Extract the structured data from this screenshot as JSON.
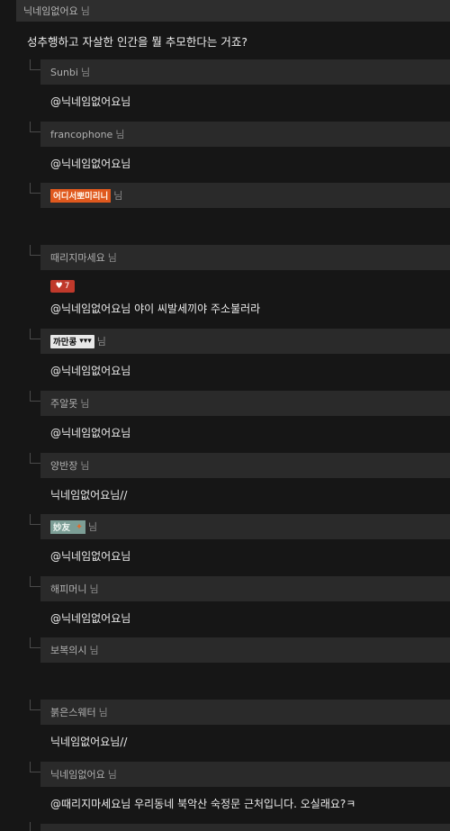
{
  "post": {
    "author": "닉네임없어요",
    "suffix": "님",
    "text": "성추행하고 자살한 인간을 뭘 추모한다는 거죠?"
  },
  "replies": [
    {
      "nick": "Sunbi",
      "suffix": "님",
      "body": "@닉네임없어요님"
    },
    {
      "nick": "francophone",
      "suffix": "님",
      "body": "@닉네임없어요님"
    },
    {
      "nick": "어디서뽀미리니",
      "suffix": "님",
      "body": ""
    },
    {
      "nick": "때리지마세요",
      "suffix": "님",
      "likes": "7",
      "body": "@닉네임없어요님 야이 씨발세끼야 주소불러라"
    },
    {
      "nick": "까만콩",
      "suffix": "님",
      "body": "@닉네임없어요님"
    },
    {
      "nick": "주알못",
      "suffix": "님",
      "body": "@닉네임없어요님"
    },
    {
      "nick": "양반장",
      "suffix": "님",
      "body": "닉네임없어요님//"
    },
    {
      "nick": "妙友",
      "suffix": "님",
      "body": "@닉네임없어요님"
    },
    {
      "nick": "해피머니",
      "suffix": "님",
      "body": "@닉네임없어요님"
    },
    {
      "nick": "보복의시",
      "suffix": "님",
      "body": ""
    },
    {
      "nick": "붉은스웨터",
      "suffix": "님",
      "body": "닉네임없어요님//"
    },
    {
      "nick": "닉네임없어요",
      "suffix": "님",
      "body": "@때리지마세요님 우리동네 북악산 숙정문 근처입니다. 오실래요?ㅋ"
    }
  ]
}
